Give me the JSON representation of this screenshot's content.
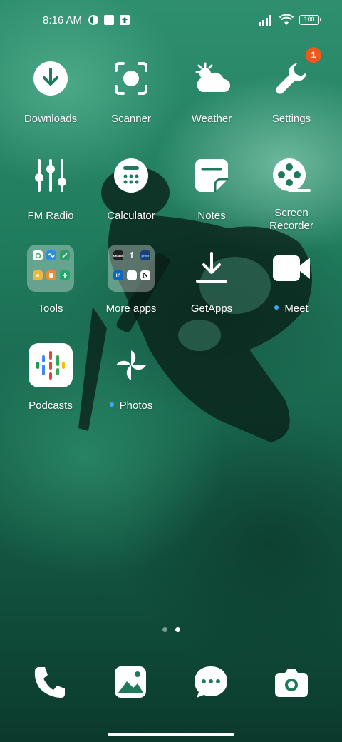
{
  "status_bar": {
    "time": "8:16 AM",
    "battery": "100",
    "icons": [
      "vpn-icon",
      "square-notification-icon",
      "upload-notification-icon",
      "signal-icon",
      "wifi-icon",
      "battery-icon"
    ]
  },
  "apps": [
    {
      "label": "Downloads",
      "icon": "download-icon"
    },
    {
      "label": "Scanner",
      "icon": "scanner-icon"
    },
    {
      "label": "Weather",
      "icon": "weather-icon"
    },
    {
      "label": "Settings",
      "icon": "wrench-icon",
      "badge": "1"
    },
    {
      "label": "FM Radio",
      "icon": "equalizer-icon"
    },
    {
      "label": "Calculator",
      "icon": "calculator-icon"
    },
    {
      "label": "Notes",
      "icon": "notes-icon"
    },
    {
      "label": "Screen Recorder",
      "icon": "film-reel-icon"
    },
    {
      "label": "Tools",
      "icon": "folder-icon"
    },
    {
      "label": "More apps",
      "icon": "folder-icon"
    },
    {
      "label": "GetApps",
      "icon": "getapps-icon"
    },
    {
      "label": "Meet",
      "icon": "video-camera-icon",
      "new_dot": true
    },
    {
      "label": "Podcasts",
      "icon": "podcasts-icon"
    },
    {
      "label": "Photos",
      "icon": "pinwheel-icon",
      "new_dot": true
    }
  ],
  "more_apps_folder": {
    "mini_labels": [
      "amazon",
      "f",
      "prime",
      "in",
      "",
      "N"
    ]
  },
  "dock": [
    {
      "name": "phone",
      "icon": "phone-icon"
    },
    {
      "name": "gallery",
      "icon": "gallery-icon"
    },
    {
      "name": "messages",
      "icon": "message-icon"
    },
    {
      "name": "camera",
      "icon": "camera-icon"
    }
  ],
  "page_indicator": {
    "pages": 2,
    "current": 2
  },
  "colors": {
    "badge": "#ef5a1c",
    "new_dot": "#3fa9f5",
    "wallpaper_primary": "#1f7a5c"
  }
}
